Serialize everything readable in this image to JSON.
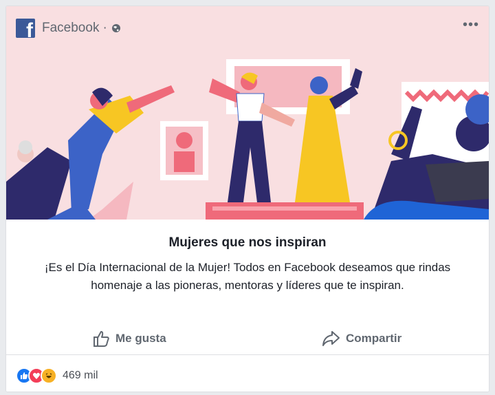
{
  "post": {
    "page_name": "Facebook",
    "separator": "·",
    "icons": {
      "logo": "facebook-logo-icon",
      "audience": "globe-icon",
      "menu": "more-options-icon"
    },
    "more_label": "•••",
    "title": "Mujeres que nos inspiran",
    "body": "¡Es el Día Internacional de la Mujer! Todos en Facebook deseamos que rindas homenaje a las pioneras, mentoras y líderes que te inspiran.",
    "banner_bg": "#f9dfe1"
  },
  "actions": {
    "like_label": "Me gusta",
    "share_label": "Compartir"
  },
  "reactions": {
    "types": [
      "like",
      "love",
      "haha"
    ],
    "count": "469 mil"
  },
  "colors": {
    "brand": "#3b5998",
    "like": "#1877f2",
    "love": "#f33e58",
    "haha": "#f7b125"
  }
}
